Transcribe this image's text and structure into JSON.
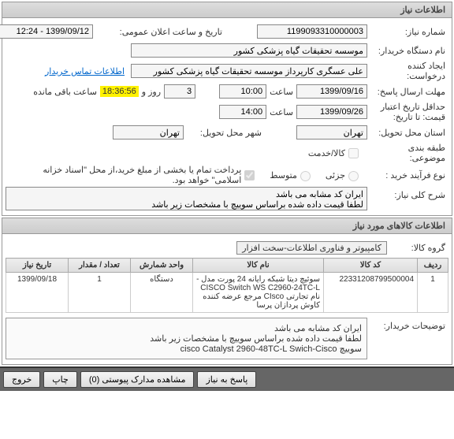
{
  "panel1_title": "اطلاعات نیاز",
  "need_no_lbl": "شماره نیاز:",
  "need_no": "1199093310000003",
  "announce_lbl": "تاریخ و ساعت اعلان عمومی:",
  "announce": "1399/09/12 - 12:24",
  "buyer_lbl": "نام دستگاه خریدار:",
  "buyer": "موسسه تحقیقات گیاه پزشکی کشور",
  "creator_lbl": "ایجاد کننده درخواست:",
  "creator": "علی عسگری کارپرداز موسسه تحقیقات گیاه پزشکی کشور",
  "contact_link": "اطلاعات تماس خریدار",
  "reply_deadline_lbl": "مهلت ارسال پاسخ:",
  "reply_date": "1399/09/16",
  "reply_time": "10:00",
  "saat_lbl": "ساعت",
  "days_val": "3",
  "rooz_lbl": "روز و",
  "countdown": "18:36:56",
  "remain_lbl": "ساعت باقی مانده",
  "valid_lbl": "حداقل تاریخ اعتبار قیمت: تا تاریخ:",
  "valid_date": "1399/09/26",
  "valid_time": "14:00",
  "deliver_pl_lbl": "استان محل تحویل:",
  "deliver_pl": "تهران",
  "deliver_city_lbl": "شهر محل تحویل:",
  "deliver_city": "تهران",
  "budget_lbl": "طبقه بندی موضوعی:",
  "budget_opt": "کالا/خدمت",
  "buy_type_lbl": "نوع فرآیند خرید :",
  "opt_low": "جزئی",
  "opt_mid": "متوسط",
  "opt_note": "پرداخت تمام یا بخشی از مبلغ خرید،از محل \"اسناد خزانه اسلامی\" خواهد بود.",
  "opt_chk_pay": "✔",
  "summary_lbl": "شرح کلی نیاز:",
  "summary": "ایران کد مشابه می باشد\nلطفا قیمت داده شده براساس سوییچ با مشخصات زیر باشد",
  "panel2_title": "اطلاعات کالاهای مورد نیاز",
  "group_lbl": "گروه کالا:",
  "group": "کامپیوتر و فناوری اطلاعات-سخت افزار",
  "th_row": "ردیف",
  "th_code": "کد کالا",
  "th_name": "نام کالا",
  "th_unit": "واحد شمارش",
  "th_qty": "تعداد / مقدار",
  "th_date": "تاریخ نیاز",
  "r1_row": "1",
  "r1_code": "22331208799500004",
  "r1_name": "سوئیچ دیتا شبکه رایانه 24 پورت مدل -CISCO Switch WS  C2960-24TC-L نام تجارتی CIsco مرجع عرضه کننده کاوش پردازان پرسا",
  "r1_unit": "دستگاه",
  "r1_qty": "1",
  "r1_date": "1399/09/18",
  "buyer_desc_lbl": "توضیحات خریدار:",
  "buyer_desc": "ایران کد مشابه می باشد\nلطفا قیمت داده شده براساس سوییچ با مشخصات زیر باشد\nسوییچ cisco Catalyst 2960-48TC-L Swich-Cisco",
  "btn_reply": "پاسخ به نیاز",
  "btn_attach": "مشاهده مدارک پیوستی  (0)",
  "btn_print": "چاپ",
  "btn_exit": "خروج"
}
